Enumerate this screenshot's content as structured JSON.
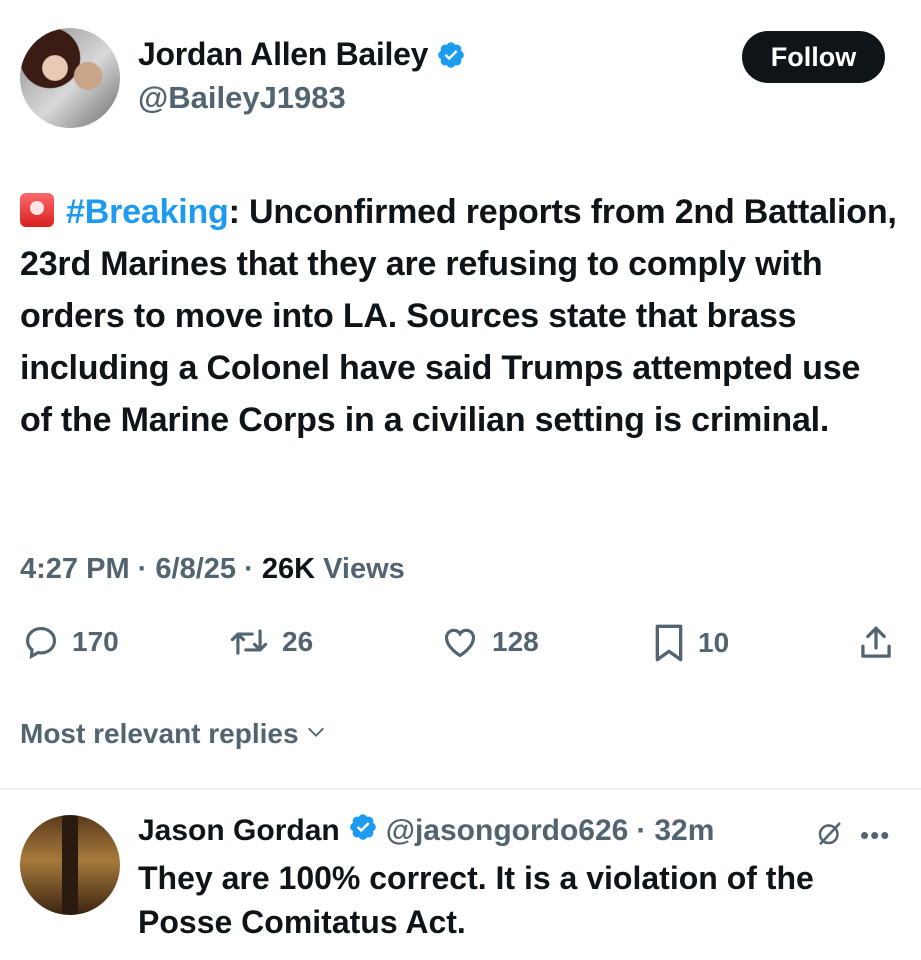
{
  "tweet": {
    "author": {
      "display_name": "Jordan Allen Bailey",
      "handle": "@BaileyJ1983",
      "verified": true
    },
    "follow_label": "Follow",
    "hashtag": "#Breaking",
    "text_after_hashtag": ": Unconfirmed reports from 2nd Battalion, 23rd Marines that they are refusing to comply with orders to move into LA. Sources state that brass including a Colonel have said Trumps attempted use of the Marine Corps in a civilian setting is criminal.",
    "time": "4:27 PM",
    "date": "6/8/25",
    "separator": "·",
    "views_count": "26K",
    "views_label": "Views",
    "stats": {
      "replies": "170",
      "reposts": "26",
      "likes": "128",
      "bookmarks": "10"
    }
  },
  "replies_sort_label": "Most relevant replies",
  "reply": {
    "display_name": "Jason Gordan",
    "handle": "@jasongordo626",
    "separator": "·",
    "age": "32m",
    "text": "They are 100% correct. It is a violation of the Posse Comitatus Act."
  },
  "colors": {
    "accent": "#1d9bf0",
    "muted": "#536471",
    "text": "#0f1419"
  }
}
